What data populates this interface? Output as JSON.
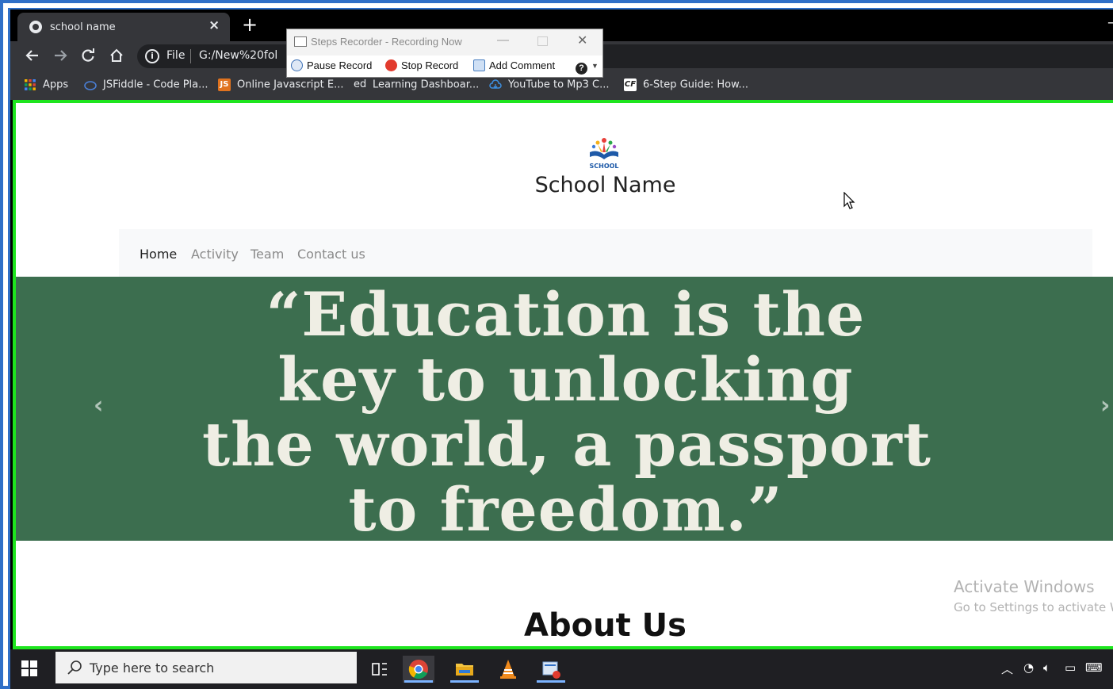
{
  "browser": {
    "tab_title": "school name",
    "tab_close": "×",
    "new_tab": "+",
    "window_minimize": "–",
    "info_icon": "i",
    "scheme_label": "File",
    "url": "G:/New%20fol",
    "bookmarks": [
      {
        "label": "Apps",
        "icon": "apps-grid-icon",
        "color": "#f4b400"
      },
      {
        "label": "JSFiddle - Code Pla...",
        "icon": "jsfiddle-icon",
        "color": "#4a7fd6"
      },
      {
        "label": "Online Javascript E...",
        "icon": "js-icon",
        "glyph": "JS",
        "color": "#e0731f"
      },
      {
        "label": "Learning Dashboar...",
        "icon": "edx-icon",
        "glyph": "ed",
        "color": "#35363a"
      },
      {
        "label": "YouTube to Mp3 C...",
        "icon": "cloud-download-icon",
        "color": "#3d8fe0"
      },
      {
        "label": "6-Step Guide: How...",
        "icon": "cf-icon",
        "glyph": "CF",
        "color": "#ffffff"
      }
    ]
  },
  "steps_recorder": {
    "title": "Steps Recorder - Recording Now",
    "pause": "Pause Record",
    "stop": "Stop Record",
    "comment": "Add Comment",
    "help_icon": "?"
  },
  "site": {
    "logo_text": "SCHOOL",
    "school_name": "School Name",
    "nav": [
      "Home",
      "Activity",
      "Team",
      "Contact us"
    ],
    "hero_quote_lines": [
      "“Education is the",
      "key to unlocking",
      "the world, a passport",
      "to freedom.”"
    ],
    "prev_arrow": "‹",
    "next_arrow": "›",
    "about_heading": "About Us"
  },
  "watermark": {
    "line1": "Activate Windows",
    "line2": "Go to Settings to activate Windows."
  },
  "taskbar": {
    "search_placeholder": "Type here to search"
  },
  "colors": {
    "hero_bg": "#3c6e4f",
    "viewport_border": "#1ee51e",
    "frame_border": "#2f6fc7"
  }
}
